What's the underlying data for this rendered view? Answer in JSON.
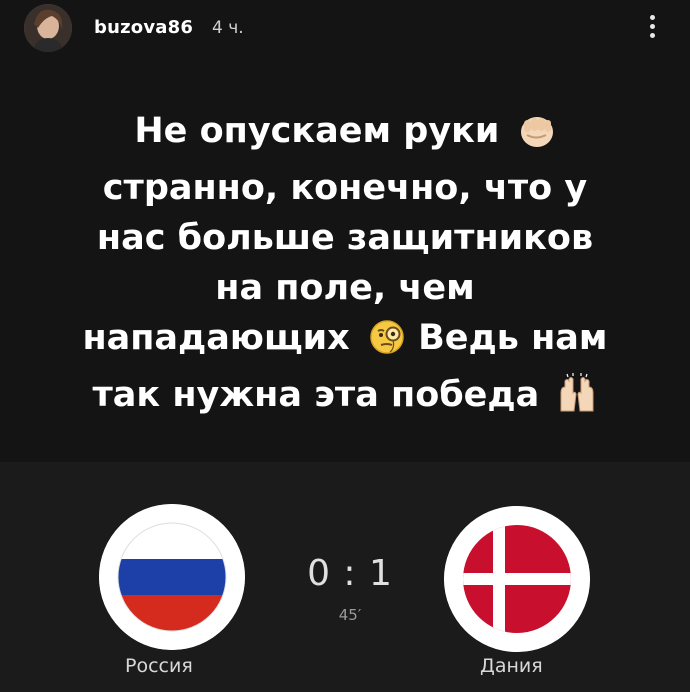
{
  "post": {
    "username": "buzova86",
    "time": "4 ч."
  },
  "story": {
    "lines": [
      "Не опускаем руки",
      "странно, конечно, что у",
      "нас больше защитников",
      "на поле, чем",
      "нападающих",
      "так нужна эта победа"
    ],
    "line5_tail": "Ведь нам",
    "emojis": [
      "raised-fist-icon",
      "monocle-face-icon",
      "raising-hands-icon"
    ]
  },
  "match": {
    "home_team": "Россия",
    "away_team": "Дания",
    "score": "0 : 1",
    "minute": "45′"
  },
  "colors": {
    "background": "#141414",
    "panel": "#1b1b1b",
    "russia_white": "#ffffff",
    "russia_blue": "#1c3fa8",
    "russia_red": "#d52b1e",
    "denmark_red": "#c8102e"
  }
}
